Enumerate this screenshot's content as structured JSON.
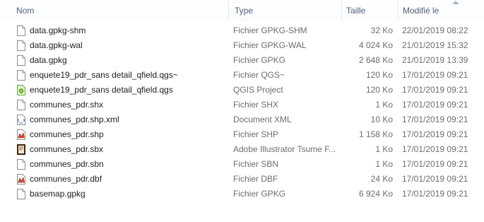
{
  "columns": {
    "name": "Nom",
    "type": "Type",
    "size": "Taille",
    "modified": "Modifié le"
  },
  "files": [
    {
      "name": "data.gpkg-shm",
      "type": "Fichier GPKG-SHM",
      "size": "32 Ko",
      "modified": "22/01/2019 08:22",
      "icon": "generic-file-icon"
    },
    {
      "name": "data.gpkg-wal",
      "type": "Fichier GPKG-WAL",
      "size": "4 024 Ko",
      "modified": "21/01/2019 15:32",
      "icon": "generic-file-icon"
    },
    {
      "name": "data.gpkg",
      "type": "Fichier GPKG",
      "size": "2 648 Ko",
      "modified": "21/01/2019 13:39",
      "icon": "generic-file-icon"
    },
    {
      "name": "enquete19_pdr_sans detail_qfield.qgs~",
      "type": "Fichier QGS~",
      "size": "120 Ko",
      "modified": "17/01/2019 09:21",
      "icon": "generic-file-icon"
    },
    {
      "name": "enquete19_pdr_sans detail_qfield.qgs",
      "type": "QGIS Project",
      "size": "120 Ko",
      "modified": "17/01/2019 09:21",
      "icon": "qgis-project-icon"
    },
    {
      "name": "communes_pdr.shx",
      "type": "Fichier SHX",
      "size": "1 Ko",
      "modified": "17/01/2019 09:21",
      "icon": "generic-file-icon"
    },
    {
      "name": "communes_pdr.shp.xml",
      "type": "Document XML",
      "size": "10 Ko",
      "modified": "17/01/2019 09:21",
      "icon": "xml-document-icon"
    },
    {
      "name": "communes_pdr.shp",
      "type": "Fichier SHP",
      "size": "1 158 Ko",
      "modified": "17/01/2019 09:21",
      "icon": "shapefile-icon"
    },
    {
      "name": "communes_pdr.sbx",
      "type": "Adobe Illustrator Tsume F...",
      "size": "1 Ko",
      "modified": "17/01/2019 09:21",
      "icon": "illustrator-file-icon"
    },
    {
      "name": "communes_pdr.sbn",
      "type": "Fichier SBN",
      "size": "1 Ko",
      "modified": "17/01/2019 09:21",
      "icon": "generic-file-icon"
    },
    {
      "name": "communes_pdr.dbf",
      "type": "Fichier DBF",
      "size": "24 Ko",
      "modified": "17/01/2019 09:21",
      "icon": "dbf-file-icon"
    },
    {
      "name": "basemap.gpkg",
      "type": "Fichier GPKG",
      "size": "6 924 Ko",
      "modified": "17/01/2019 09:21",
      "icon": "generic-file-icon"
    }
  ],
  "colors": {
    "header_text": "#4c607a",
    "secondary_text": "#6d6d6d",
    "primary_text": "#1e1e1e"
  }
}
